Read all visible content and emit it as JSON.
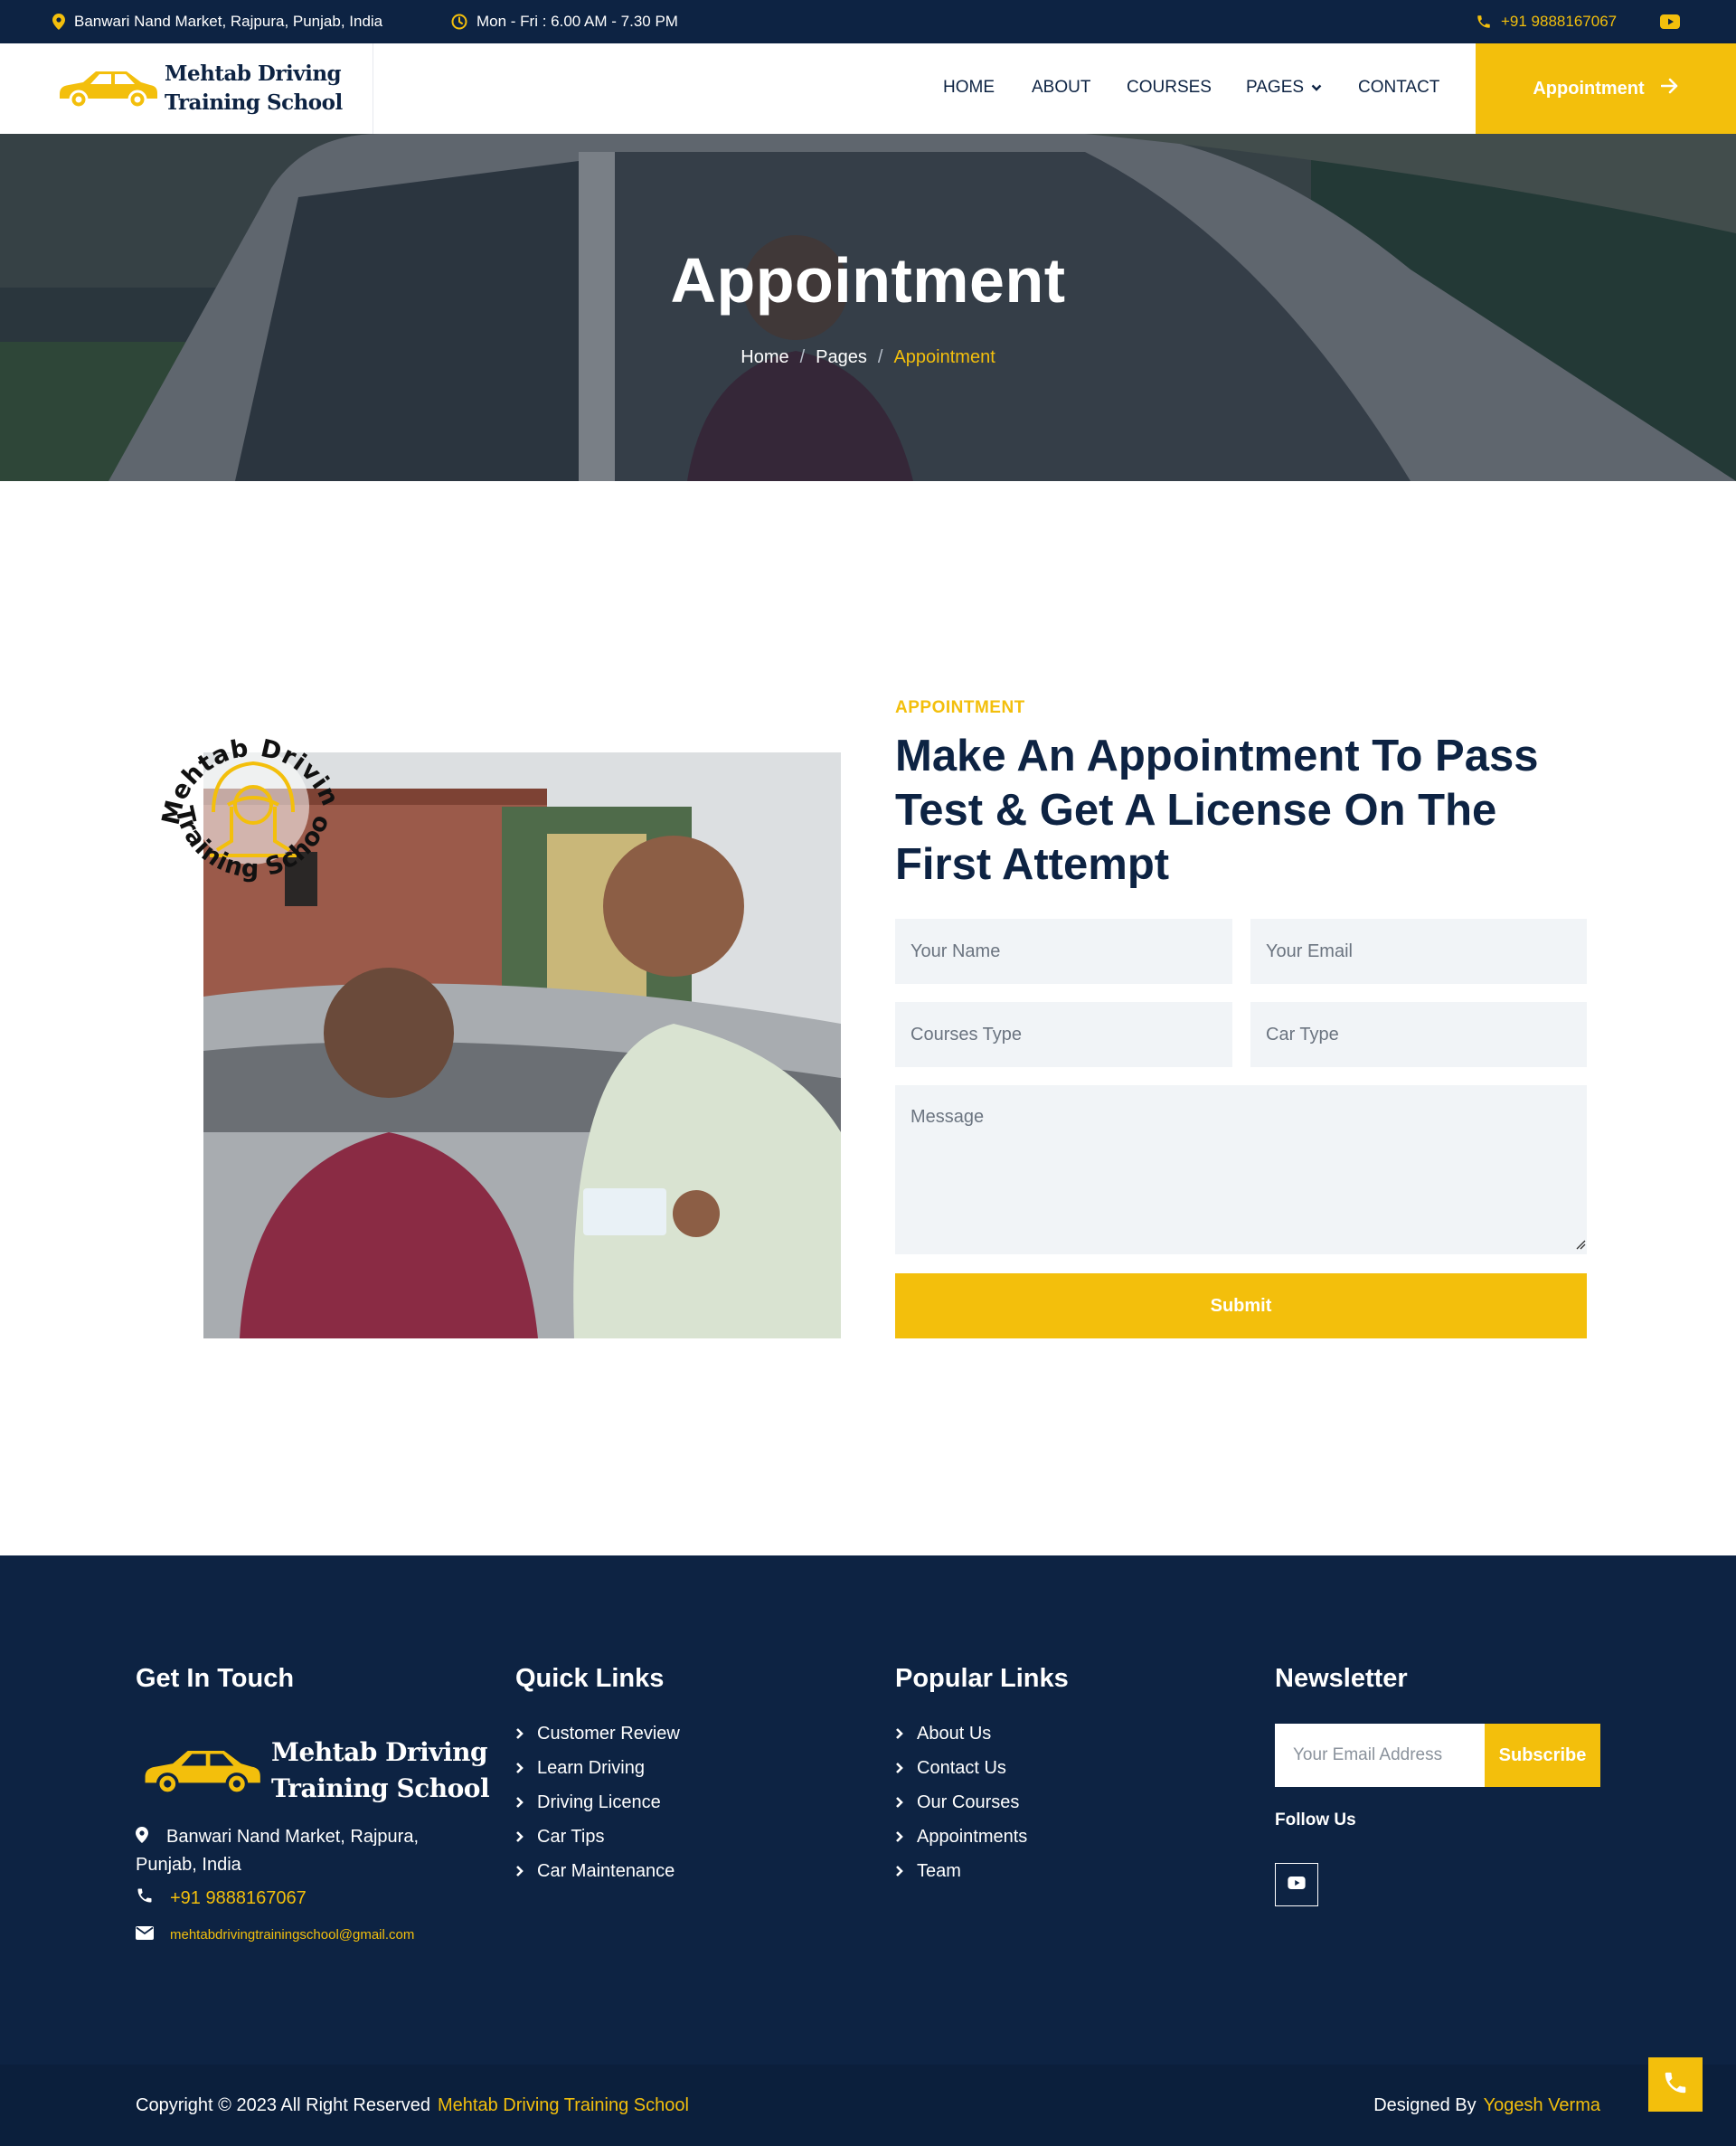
{
  "colors": {
    "navy": "#0d2343",
    "accent": "#f3bf0c",
    "field_bg": "#f1f4f7"
  },
  "topbar": {
    "address": "Banwari Nand Market, Rajpura, Punjab, India",
    "hours": "Mon - Fri : 6.00 AM - 7.30 PM",
    "phone": "+91 9888167067",
    "icons": [
      "map-pin-icon",
      "clock-icon",
      "phone-icon",
      "youtube-icon"
    ]
  },
  "nav": {
    "brand_line1": "Mehtab Driving",
    "brand_line2": "Training School",
    "items": [
      "HOME",
      "ABOUT",
      "COURSES",
      "PAGES",
      "CONTACT"
    ],
    "cta": "Appointment"
  },
  "hero": {
    "title": "Appointment",
    "breadcrumbs": [
      "Home",
      "Pages",
      "Appointment"
    ],
    "separator": "/"
  },
  "appointment": {
    "badge_top": "Mehtab Driving",
    "badge_bottom": "Training School",
    "kicker": "APPOINTMENT",
    "heading_lines": [
      "Make An Appointment To Pass",
      "Test & Get A License On The",
      "First Attempt"
    ],
    "form": {
      "name_placeholder": "Your Name",
      "email_placeholder": "Your Email",
      "course_placeholder": "Courses Type",
      "car_placeholder": "Car Type",
      "message_placeholder": "Message",
      "submit": "Submit"
    }
  },
  "footer": {
    "contact": {
      "title": "Get In Touch",
      "brand_line1": "Mehtab Driving",
      "brand_line2": "Training School",
      "address": "Banwari Nand Market, Rajpura, Punjab, India",
      "phone": "+91 9888167067",
      "email": "mehtabdrivingtrainingschool@gmail.com"
    },
    "quick_links": {
      "title": "Quick Links",
      "items": [
        "Customer Review",
        "Learn Driving",
        "Driving Licence",
        "Car Tips",
        "Car Maintenance"
      ]
    },
    "popular_links": {
      "title": "Popular Links",
      "items": [
        "About Us",
        "Contact Us",
        "Our Courses",
        "Appointments",
        "Team"
      ]
    },
    "newsletter": {
      "title": "Newsletter",
      "placeholder": "Your Email Address",
      "button": "Subscribe",
      "follow": "Follow Us"
    }
  },
  "copyright": {
    "prefix": "Copyright © 2023 All Right Reserved",
    "brand": "Mehtab Driving Training School",
    "designed_by": "Designed By",
    "designer": "Yogesh Verma"
  }
}
